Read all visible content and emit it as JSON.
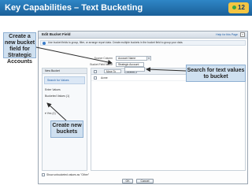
{
  "header": {
    "title": "Key Capabilities – Text Bucketing",
    "badge_text": "12",
    "colors": {
      "bar": "#1f6fb0",
      "badge": "#f4c542"
    }
  },
  "dialog": {
    "title": "Edit Bucket Field",
    "help_link": "Help for this Page",
    "close_glyph": "×",
    "info_text": "Use bucket fields to group, filter, or arrange report data. Create multiple buckets in the bucket field to group your data.",
    "source_column_label": "Source Column",
    "source_column_value": "Account Name",
    "field_name_label": "Bucket Field Name",
    "field_name_value": "Strategic Account",
    "left_panel": {
      "header": "New Bucket",
      "search_item": "Search for Values",
      "items": [
        "Enter Values",
        "Bucketed Values (1)",
        "▾ Yes (1)"
      ]
    },
    "grid": {
      "filter_select": "Move To",
      "search_label": "Search",
      "rows": [
        "Acme"
      ]
    },
    "footer_checkbox_label": "Show unbucketed values as \"Other\"",
    "ok_button": "OK",
    "cancel_button": "Cancel"
  },
  "callouts": {
    "create_field": "Create a new bucket field for Strategic Accounts",
    "search_text": "Search for text values to bucket",
    "create_buckets": "Create new buckets"
  }
}
